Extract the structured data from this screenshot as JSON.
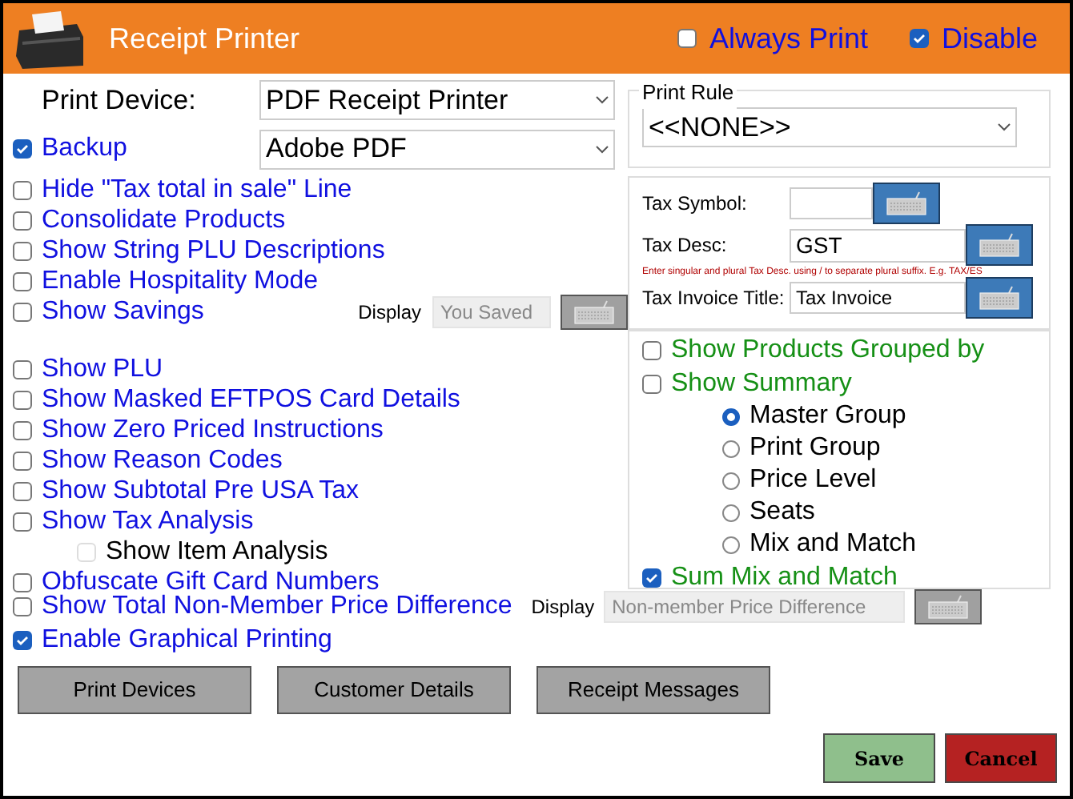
{
  "header": {
    "title": "Receipt Printer",
    "always_print": {
      "label": "Always Print",
      "checked": false
    },
    "disable": {
      "label": "Disable",
      "checked": true
    }
  },
  "print_device": {
    "label": "Print Device:",
    "value": "PDF Receipt Printer"
  },
  "backup": {
    "label": "Backup",
    "checked": true,
    "value": "Adobe PDF"
  },
  "options_1": [
    {
      "label": "Hide \"Tax total in sale\" Line",
      "checked": false
    },
    {
      "label": "Consolidate Products",
      "checked": false
    },
    {
      "label": "Show String PLU Descriptions",
      "checked": false
    },
    {
      "label": "Enable Hospitality Mode",
      "checked": false
    },
    {
      "label": "Show Savings",
      "checked": false,
      "display": {
        "label": "Display",
        "placeholder": "You Saved"
      }
    }
  ],
  "options_2": [
    {
      "label": "Show PLU",
      "checked": false
    },
    {
      "label": "Show Masked EFTPOS Card Details",
      "checked": false
    },
    {
      "label": "Show Zero Priced Instructions",
      "checked": false
    },
    {
      "label": "Show Reason Codes",
      "checked": false
    },
    {
      "label": "Show Subtotal Pre USA Tax",
      "checked": false
    },
    {
      "label": "Show Tax Analysis",
      "checked": false,
      "children": [
        {
          "label": "Show Item Analysis",
          "checked": false,
          "disabled": true
        }
      ]
    },
    {
      "label": "Obfuscate Gift Card Numbers",
      "checked": false
    }
  ],
  "print_rule": {
    "label": "Print Rule",
    "value": "<<NONE>>"
  },
  "tax": {
    "symbol": {
      "label": "Tax Symbol:"
    },
    "desc": {
      "label": "Tax Desc:",
      "value": "GST"
    },
    "hint": "Enter singular and plural Tax Desc. using / to separate plural suffix.  E.g.  TAX/ES",
    "invoice_title": {
      "label": "Tax Invoice Title:",
      "value": "Tax Invoice"
    }
  },
  "grouping": {
    "show_products_grouped_by": {
      "label": "Show Products Grouped by",
      "checked": false
    },
    "show_summary": {
      "label": "Show Summary",
      "checked": false
    },
    "groups": [
      {
        "label": "Master Group",
        "selected": true
      },
      {
        "label": "Print Group",
        "selected": false
      },
      {
        "label": "Price Level",
        "selected": false
      },
      {
        "label": "Seats",
        "selected": false
      },
      {
        "label": "Mix and Match",
        "selected": false
      }
    ],
    "sum_mix_and_match": {
      "label": "Sum Mix and Match",
      "checked": true
    }
  },
  "options_3": [
    {
      "label": "Show Total Non-Member Price Difference",
      "checked": false,
      "display": {
        "label": "Display",
        "placeholder": "Non-member Price Difference"
      }
    },
    {
      "label": "Enable Graphical Printing",
      "checked": true
    }
  ],
  "buttons": [
    "Print Devices",
    "Customer Details",
    "Receipt Messages"
  ],
  "actions": [
    {
      "label": "Save",
      "kind": "save"
    },
    {
      "label": "Cancel",
      "kind": "cancel"
    }
  ]
}
